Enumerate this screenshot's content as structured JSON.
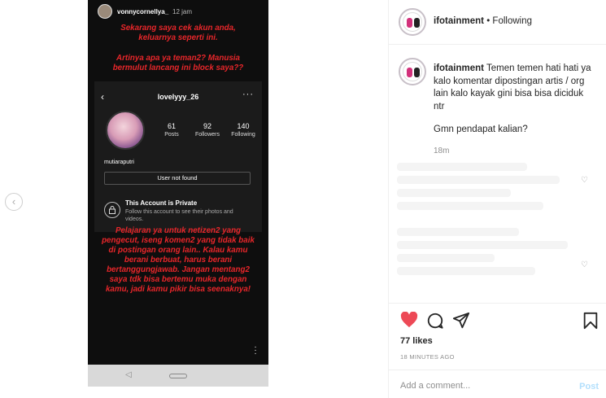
{
  "story": {
    "username": "vonnycornellya_",
    "time": "12 jam",
    "text1": "Sekarang saya cek akun anda, keluarnya seperti ini.",
    "text2": "Artinya apa ya teman2? Manusia bermulut lancang ini block saya??",
    "text3": "Pelajaran ya untuk netizen2 yang pengecut, iseng komen2 yang tidak baik di postingan orang lain.. Kalau kamu berani berbuat, harus berani bertanggungjawab. Jangan mentang2 saya tdk bisa bertemu muka dengan kamu, jadi kamu pikir bisa seenaknya!"
  },
  "profile": {
    "username": "lovelyyy_26",
    "posts_count": "61",
    "posts_label": "Posts",
    "followers_count": "92",
    "followers_label": "Followers",
    "following_count": "140",
    "following_label": "Following",
    "name": "mutiaraputri",
    "not_found": "User not found",
    "private_title": "This Account is Private",
    "private_desc": "Follow this account to see their photos and videos."
  },
  "header": {
    "username": "ifotainment",
    "separator": "•",
    "follow_status": "Following"
  },
  "caption": {
    "username": "ifotainment",
    "text": "Temen temen hati hati ya kalo komentar dipostingan artis / org lain kalo kayak gini bisa bisa diciduk ntr",
    "question": "Gmn pendapat kalian?",
    "time": "18m"
  },
  "stats": {
    "likes": "77 likes",
    "posted_ago": "18 MINUTES AGO"
  },
  "comment": {
    "placeholder": "Add a comment...",
    "post_label": "Post"
  },
  "colors": {
    "story_text": "#e8262a",
    "heart": "#ed4956",
    "post_disabled": "#b2dffc"
  },
  "icons": {
    "like": "heart-icon",
    "comment": "comment-icon",
    "share": "share-icon",
    "save": "bookmark-icon"
  }
}
